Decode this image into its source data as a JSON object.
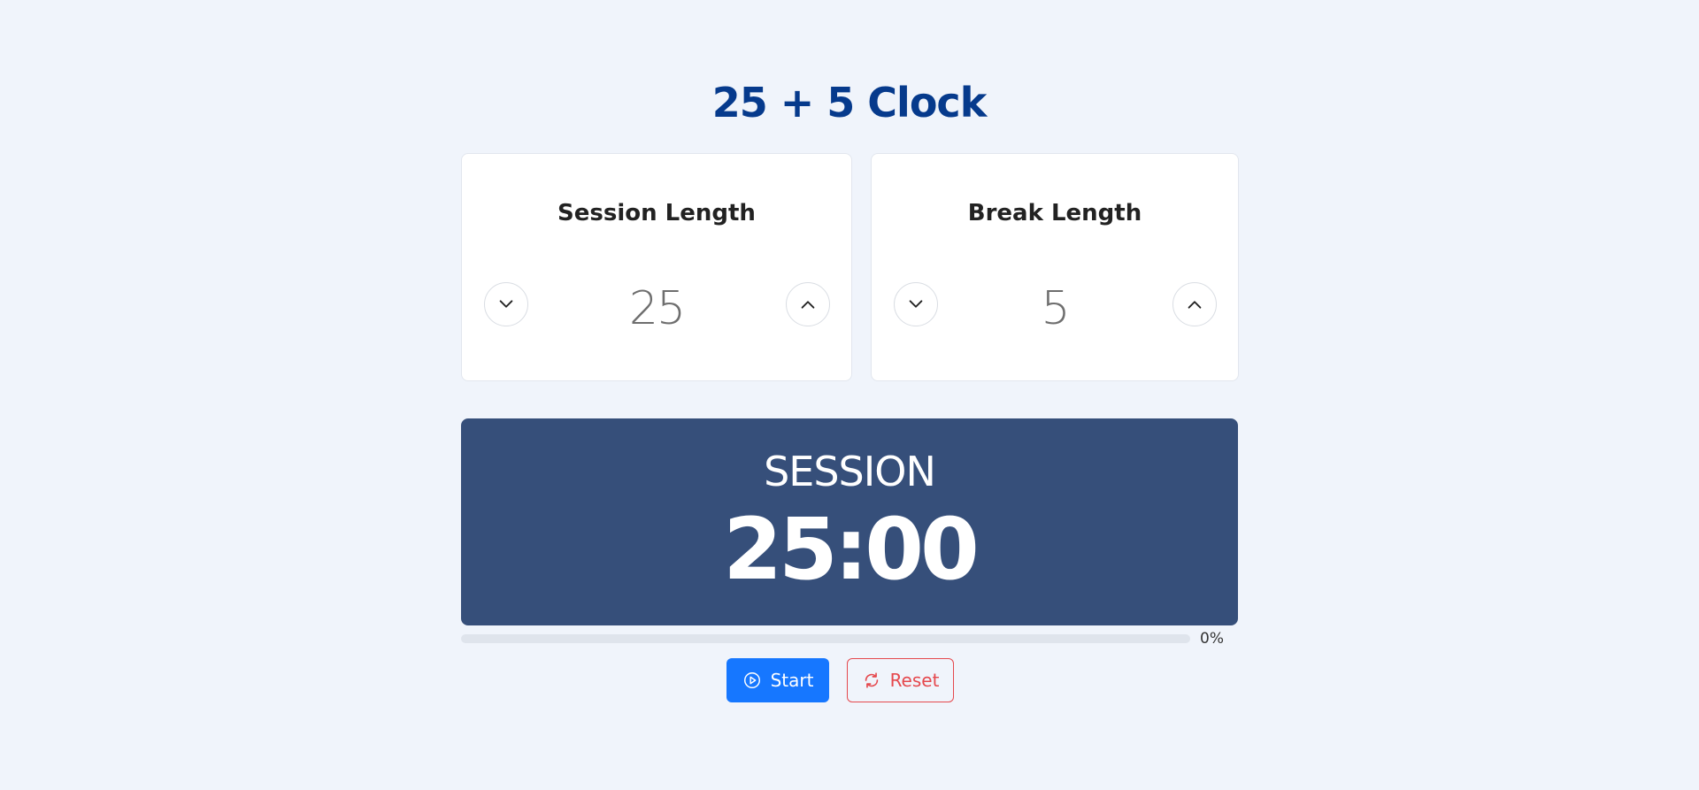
{
  "title": "25 + 5 Clock",
  "session": {
    "label": "Session Length",
    "value": "25"
  },
  "break": {
    "label": "Break Length",
    "value": "5"
  },
  "timer": {
    "label": "SESSION",
    "time_left": "25:00"
  },
  "progress": {
    "percent": 0,
    "text": "0%"
  },
  "controls": {
    "start_label": "Start",
    "reset_label": "Reset"
  },
  "icons": {
    "decrement": "chevron-down-icon",
    "increment": "chevron-up-icon",
    "start": "play-circle-icon",
    "reset": "refresh-icon"
  },
  "colors": {
    "background": "#f0f4fb",
    "title": "#063a8c",
    "display": "#364f7a",
    "start_button": "#1677ff",
    "reset_button": "#e5484d"
  }
}
